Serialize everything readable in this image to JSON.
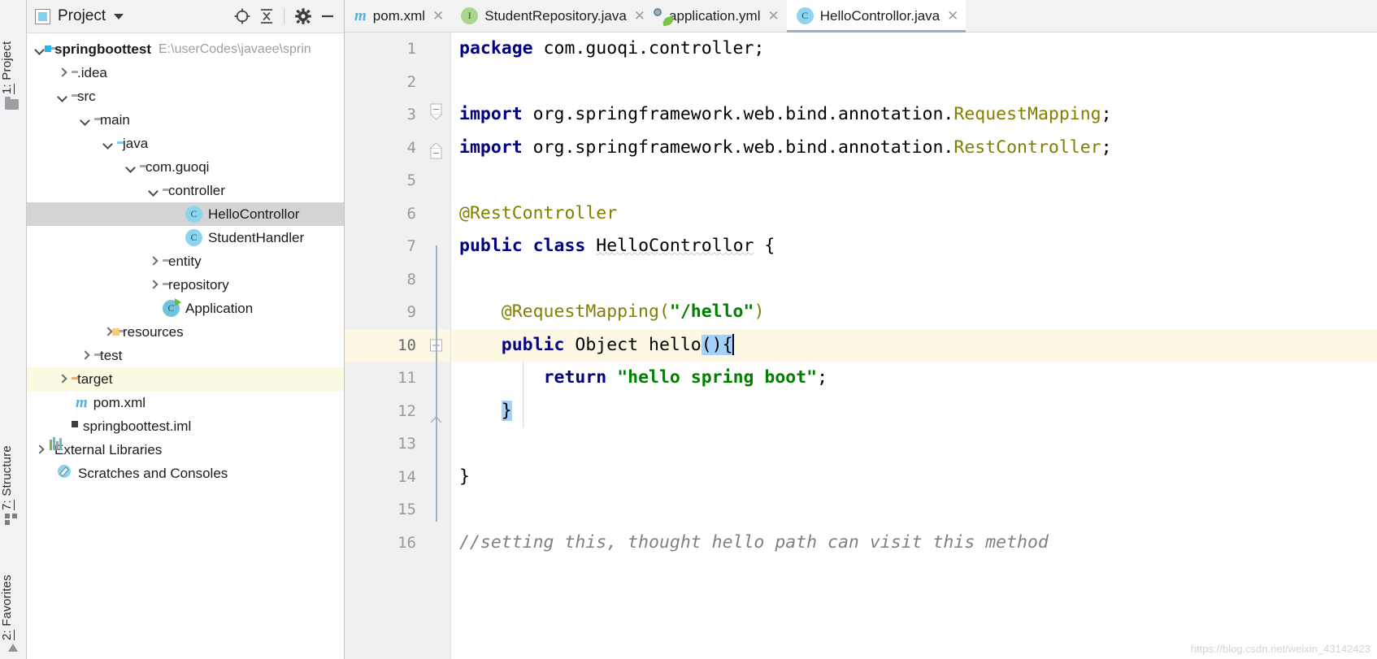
{
  "toolstrip": {
    "project_label_num": "1:",
    "project_label": "Project",
    "structure_label_num": "7:",
    "structure_label": "Structure",
    "favorites_label_num": "2:",
    "favorites_label": "Favorites",
    "folder_icon": "folder-icon",
    "structure_icon": "structure-icon",
    "favorites_icon": "favorites-icon"
  },
  "panel": {
    "title": "Project",
    "dropdown_icon": "chevron-down-icon",
    "locate_icon": "locate-target-icon",
    "collapse_icon": "collapse-all-icon",
    "settings_icon": "gear-icon",
    "hide_icon": "minimize-icon"
  },
  "tree": {
    "items": [
      {
        "label": "springboottest",
        "path": "E:\\userCodes\\javaee\\sprin",
        "icon": "module-folder-icon",
        "indent": 0,
        "arrow": "down",
        "bold": true,
        "state": "normal"
      },
      {
        "label": ".idea",
        "path": "",
        "icon": "folder-icon",
        "indent": 1,
        "arrow": "right",
        "bold": false,
        "state": "normal"
      },
      {
        "label": "src",
        "path": "",
        "icon": "folder-icon",
        "indent": 1,
        "arrow": "down",
        "bold": false,
        "state": "normal"
      },
      {
        "label": "main",
        "path": "",
        "icon": "folder-icon",
        "indent": 2,
        "arrow": "down",
        "bold": false,
        "state": "normal"
      },
      {
        "label": "java",
        "path": "",
        "icon": "source-folder-icon",
        "indent": 3,
        "arrow": "down",
        "bold": false,
        "state": "normal"
      },
      {
        "label": "com.guoqi",
        "path": "",
        "icon": "package-icon",
        "indent": 4,
        "arrow": "down",
        "bold": false,
        "state": "normal"
      },
      {
        "label": "controller",
        "path": "",
        "icon": "package-icon",
        "indent": 5,
        "arrow": "down",
        "bold": false,
        "state": "normal"
      },
      {
        "label": "HelloControllor",
        "path": "",
        "icon": "java-class-icon",
        "indent": 6,
        "arrow": "none",
        "bold": false,
        "state": "selected"
      },
      {
        "label": "StudentHandler",
        "path": "",
        "icon": "java-class-icon",
        "indent": 6,
        "arrow": "none",
        "bold": false,
        "state": "normal"
      },
      {
        "label": "entity",
        "path": "",
        "icon": "package-icon",
        "indent": 5,
        "arrow": "right",
        "bold": false,
        "state": "normal"
      },
      {
        "label": "repository",
        "path": "",
        "icon": "package-icon",
        "indent": 5,
        "arrow": "right",
        "bold": false,
        "state": "normal"
      },
      {
        "label": "Application",
        "path": "",
        "icon": "spring-class-icon",
        "indent": 5,
        "arrow": "none",
        "bold": false,
        "state": "normal"
      },
      {
        "label": "resources",
        "path": "",
        "icon": "resources-folder-icon",
        "indent": 3,
        "arrow": "right",
        "bold": false,
        "state": "normal"
      },
      {
        "label": "test",
        "path": "",
        "icon": "folder-icon",
        "indent": 2,
        "arrow": "right",
        "bold": false,
        "state": "normal"
      },
      {
        "label": "target",
        "path": "",
        "icon": "excluded-folder-icon",
        "indent": 1,
        "arrow": "right",
        "bold": false,
        "state": "tinted"
      },
      {
        "label": "pom.xml",
        "path": "",
        "icon": "maven-icon",
        "indent": 2,
        "arrow": "none",
        "bold": false,
        "state": "normal"
      },
      {
        "label": "springboottest.iml",
        "path": "",
        "icon": "iml-file-icon",
        "indent": 2,
        "arrow": "none",
        "bold": false,
        "state": "normal"
      },
      {
        "label": "External Libraries",
        "path": "",
        "icon": "library-icon",
        "indent": 0,
        "arrow": "right",
        "bold": false,
        "state": "normal"
      },
      {
        "label": "Scratches and Consoles",
        "path": "",
        "icon": "scratches-icon",
        "indent": 0,
        "arrow": "none",
        "bold": false,
        "state": "normal"
      }
    ]
  },
  "tabs": [
    {
      "label": "pom.xml",
      "icon": "maven-icon",
      "active": false,
      "close_icon": "close-icon"
    },
    {
      "label": "StudentRepository.java",
      "icon": "java-interface-icon",
      "active": false,
      "close_icon": "close-icon"
    },
    {
      "label": "application.yml",
      "icon": "spring-yaml-icon",
      "active": false,
      "close_icon": "close-icon"
    },
    {
      "label": "HelloControllor.java",
      "icon": "java-class-icon",
      "active": true,
      "close_icon": "close-icon"
    }
  ],
  "editor": {
    "line_numbers": [
      "1",
      "2",
      "3",
      "4",
      "5",
      "6",
      "7",
      "8",
      "9",
      "10",
      "11",
      "12",
      "13",
      "14",
      "15",
      "16"
    ],
    "current_line": 10,
    "gutter_marks": {
      "7": "spring-bean-gutter-icon"
    },
    "lines": [
      "package com.guoqi.controller;",
      "",
      "import org.springframework.web.bind.annotation.RequestMapping;",
      "import org.springframework.web.bind.annotation.RestController;",
      "",
      "@RestController",
      "public class HelloControllor {",
      "",
      "    @RequestMapping(\"/hello\")",
      "    public Object hello(){",
      "        return \"hello spring boot\";",
      "    }",
      "",
      "}",
      "",
      "//setting this, thought hello path can visit this method"
    ],
    "selection_text": "(){",
    "watermark": "https://blog.csdn.net/weixin_43142423"
  },
  "colors": {
    "keyword": "#000080",
    "annotation": "#808000",
    "string": "#008000",
    "comment": "#808080",
    "selection": "#a6d2fa",
    "current_line": "#fdf8e3",
    "tree_selected": "#d4d4d4",
    "tab_active_underline": "#9badc6"
  }
}
